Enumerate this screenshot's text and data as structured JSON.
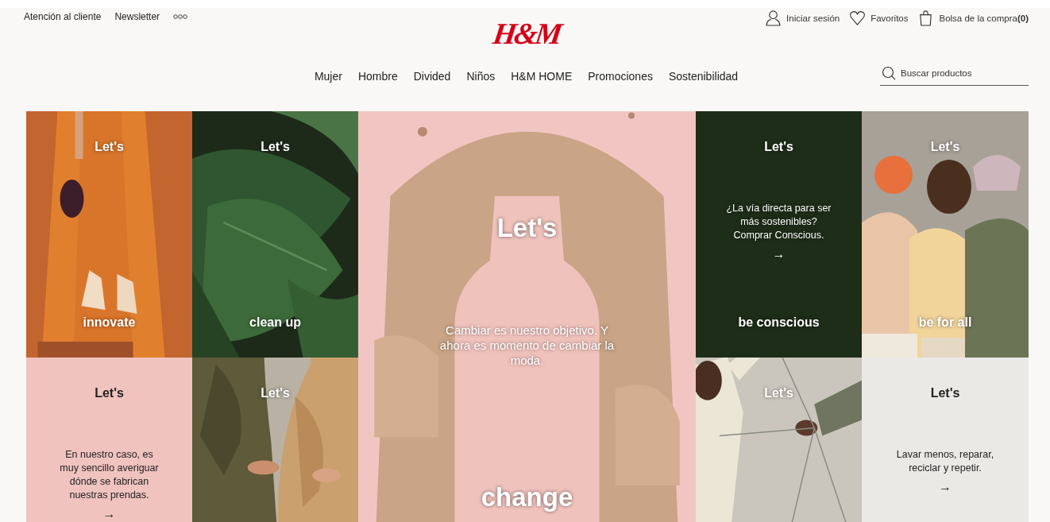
{
  "top_links": [
    "Atención al cliente",
    "Newsletter"
  ],
  "logo": "H&M",
  "account": [
    {
      "kind": "user",
      "label": "Iniciar sesión"
    },
    {
      "kind": "heart",
      "label": "Favoritos"
    },
    {
      "kind": "bag",
      "label": "Bolsa de la compra**(0)**"
    }
  ],
  "nav": [
    "Mujer",
    "Hombre",
    "Divided",
    "Niños",
    "H&M HOME",
    "Promociones",
    "Sostenibilidad"
  ],
  "search": {
    "placeholder": "Buscar productos"
  },
  "tiles": [
    {
      "heading": "Let's",
      "caption": "innovate"
    },
    {
      "heading": "Let's",
      "caption": "clean up"
    },
    {
      "kind": "feature",
      "heading": "Let's",
      "text": "Cambiar es nuestro objetivo. Y ahora es momento de cambiar la moda.",
      "caption": "change"
    },
    {
      "kind": "panel",
      "color": "#1e2d18",
      "heading": "Let's",
      "text": "¿La vía directa para ser más sostenibles? Comprar Conscious.",
      "arrow": "→",
      "caption": "be conscious"
    },
    {
      "heading": "Let's",
      "caption": "be for all"
    },
    {
      "kind": "panel",
      "color": "#f0c3bf",
      "heading": "Let's",
      "text": "En nuestro caso, es muy sencillo averiguar dónde se fabrican nuestras prendas.",
      "arrow": "→"
    },
    {
      "heading": "Let's"
    },
    {
      "heading": "Let's"
    },
    {
      "kind": "panel",
      "color": "#ebe9e6",
      "heading": "Let's",
      "text": "Lavar menos, reparar, reciclar y repetir.",
      "arrow": "→"
    }
  ]
}
